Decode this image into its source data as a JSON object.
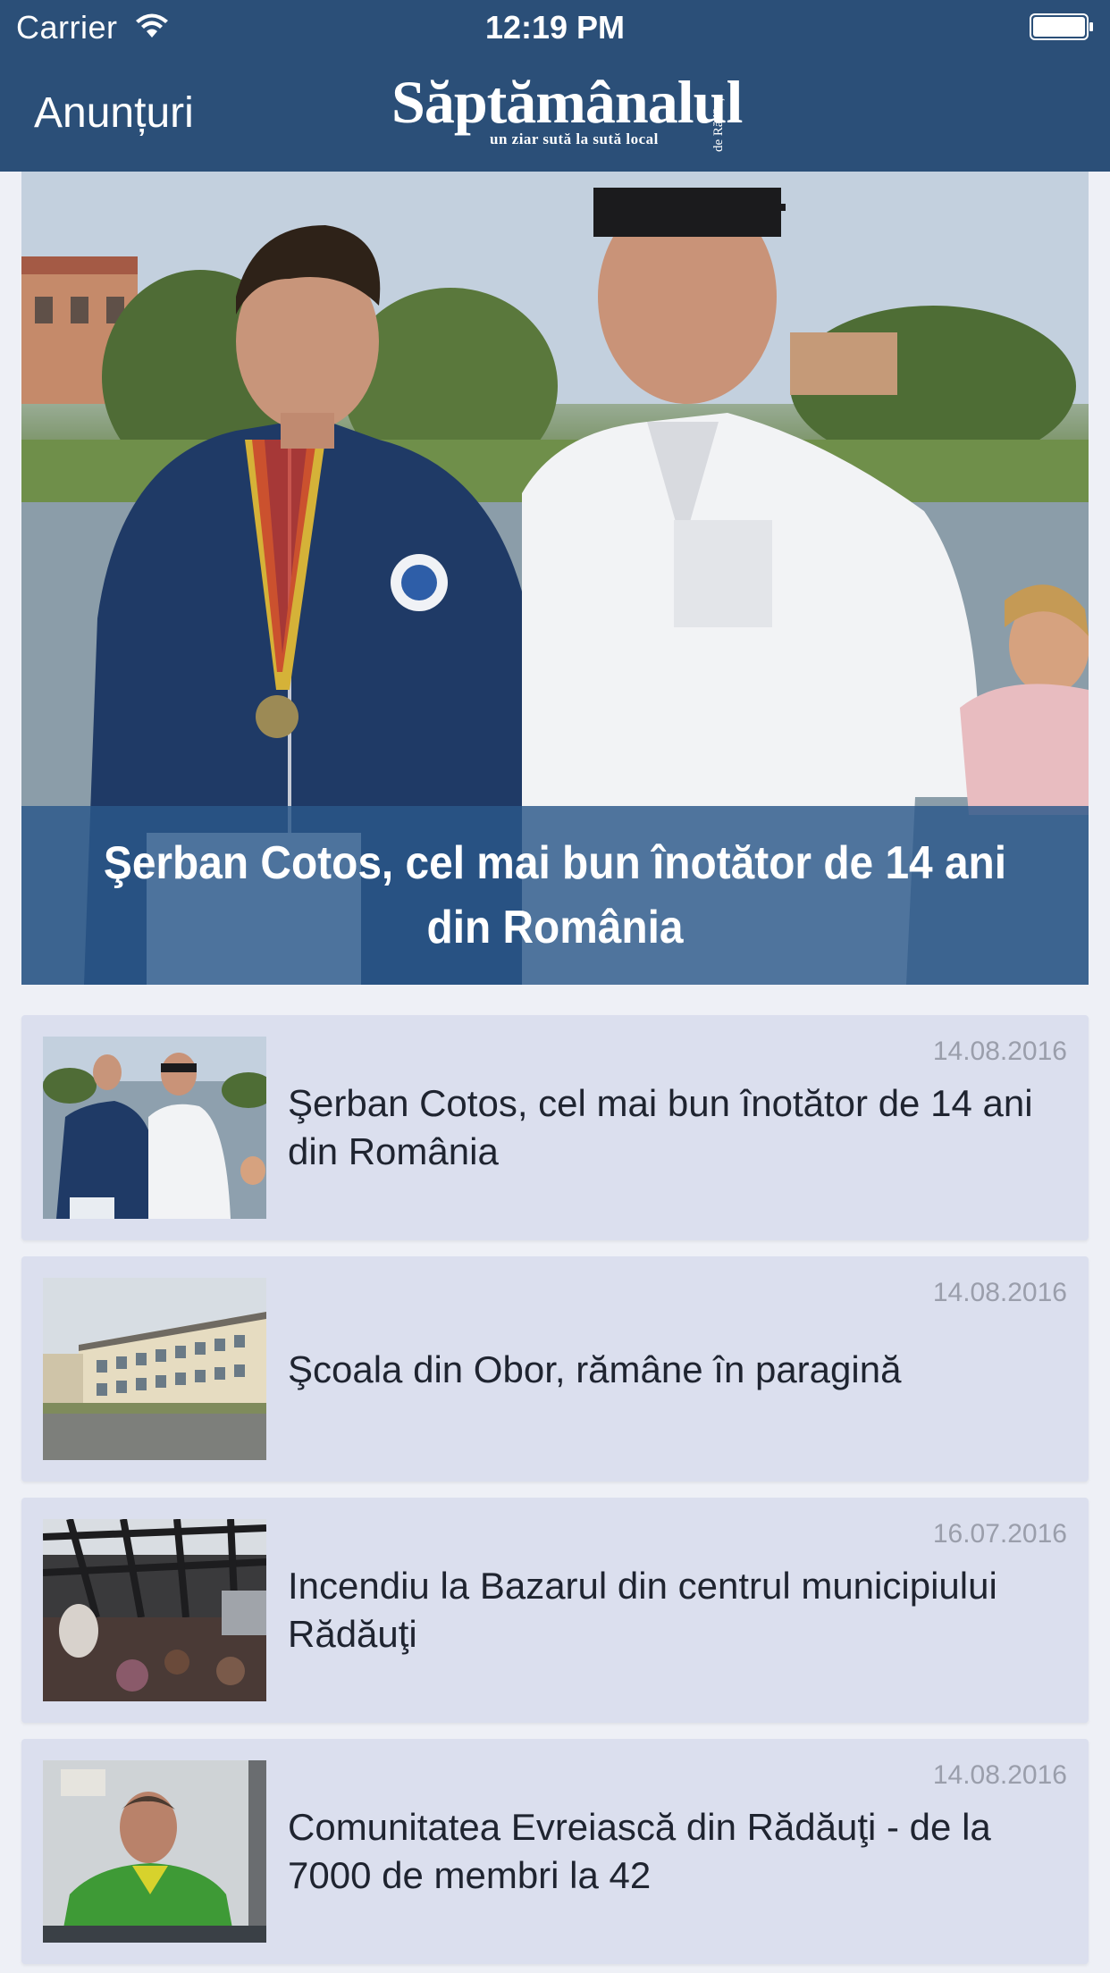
{
  "status_bar": {
    "carrier": "Carrier",
    "time": "12:19 PM"
  },
  "nav": {
    "back_label": "Anunțuri",
    "logo_main": "Săptămânalul",
    "logo_tagline": "un ziar sută la sută local",
    "logo_side": "de Rădăuți"
  },
  "hero": {
    "title": "Şerban Cotos, cel mai bun înotător de 14 ani din România",
    "image": "hero-photo"
  },
  "articles": [
    {
      "date": "14.08.2016",
      "title": "Şerban Cotos, cel mai bun înotător de 14 ani din România",
      "thumb": "swimmer-thumbnail"
    },
    {
      "date": "14.08.2016",
      "title": "Şcoala din Obor, rămâne în paragină",
      "thumb": "school-thumbnail"
    },
    {
      "date": "16.07.2016",
      "title": "Incendiu la Bazarul din centrul municipiului Rădăuţi",
      "thumb": "fire-thumbnail"
    },
    {
      "date": "14.08.2016",
      "title": "Comunitatea Evreiască din Rădăuţi - de la 7000 de membri la 42",
      "thumb": "portrait-thumbnail"
    }
  ],
  "colors": {
    "nav_bg": "#2b4f78",
    "caption_bg": "#2b588a",
    "card_bg": "#dbdfee",
    "page_bg": "#eef0f6"
  }
}
